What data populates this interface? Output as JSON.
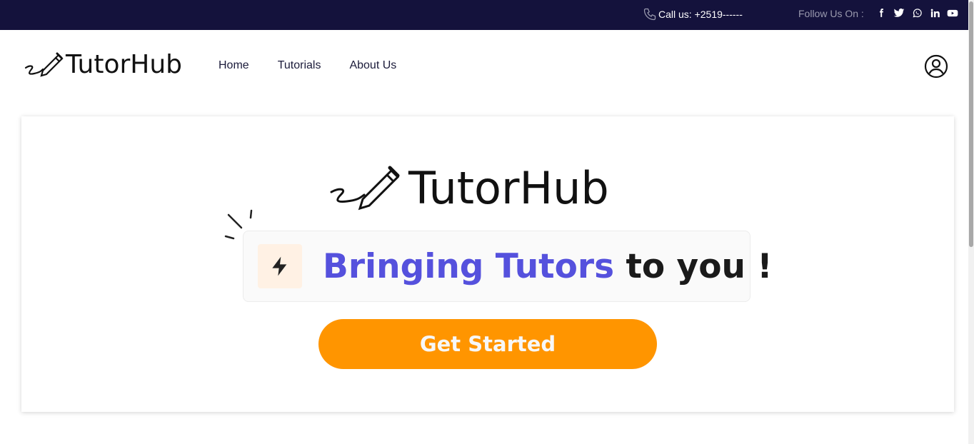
{
  "topbar": {
    "call_text": "Call us: +2519------",
    "follow_label": "Follow Us On :",
    "socials": [
      "facebook-icon",
      "twitter-icon",
      "whatsapp-icon",
      "linkedin-icon",
      "youtube-icon"
    ],
    "background": "#14123c"
  },
  "nav": {
    "logo_text": "TutorHub",
    "links": [
      "Home",
      "Tutorials",
      "About Us"
    ],
    "user_icon": "user-circle-icon"
  },
  "hero": {
    "logo_text": "TutorHub",
    "tagline_accent": "Bringing Tutors",
    "tagline_rest": "to you !",
    "tagline_icon": "bolt-icon",
    "cta_label": "Get Started",
    "accent_color": "#5551dd",
    "cta_color": "#ff9500"
  }
}
